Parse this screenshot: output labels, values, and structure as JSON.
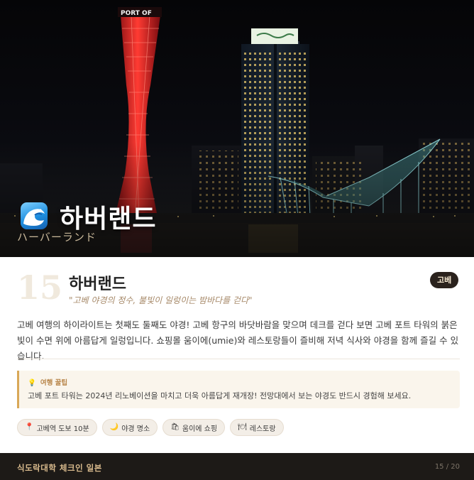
{
  "hero": {
    "title": "하버랜드",
    "subtitle": "ハーバーランド",
    "tower_sign": "PORT OF",
    "icon": "wave-icon"
  },
  "spot": {
    "number": "15",
    "title": "하버랜드",
    "quote": "\"고베 야경의 정수, 불빛이 일렁이는 밤바다를 걷다\"",
    "area_badge": "고베",
    "description": "고베 여행의 하이라이트는 첫째도 둘째도 야경! 고베 항구의 바닷바람을 맞으며 데크를 걷다 보면 고베 포트 타워의 붉은 빛이 수면 위에 아름답게 일렁입니다. 쇼핑몰 움이에(umie)와 레스토랑들이 즐비해 저녁 식사와 야경을 함께 즐길 수 있습니다."
  },
  "tip": {
    "icon": "lightbulb-icon",
    "label": "여행 꿀팁",
    "text": "고베 포트 타워는 2024년 리노베이션을 마치고 더욱 아름답게 재개장! 전망대에서 보는 야경도 반드시 경험해 보세요."
  },
  "tags": [
    {
      "icon": "pin-icon",
      "glyph": "📍",
      "label": "고베역 도보 10분"
    },
    {
      "icon": "moon-icon",
      "glyph": "🌙",
      "label": "야경 명소"
    },
    {
      "icon": "shopping-icon",
      "glyph": "🛍",
      "label": "움이에 쇼핑"
    },
    {
      "icon": "restaurant-icon",
      "glyph": "🍽",
      "label": "레스토랑"
    }
  ],
  "footer": {
    "brand": "식도락대학 체크인 일본",
    "page": "15 / 20"
  },
  "colors": {
    "accent": "#d9a857",
    "badge_bg": "#2a221d",
    "tower_red": "#e0242a",
    "museum_teal": "#7fd6d6"
  }
}
